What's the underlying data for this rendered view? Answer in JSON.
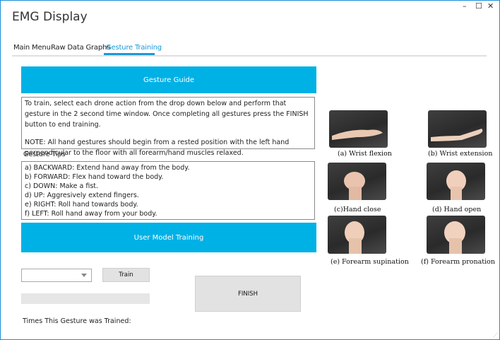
{
  "window": {
    "title": "EMG Display",
    "controls": {
      "minimize": "–",
      "maximize": "☐",
      "close": "✕"
    }
  },
  "tabs": [
    {
      "label": "Main Menu",
      "active": false
    },
    {
      "label": "Raw Data Graphs",
      "active": false
    },
    {
      "label": "Gesture Training",
      "active": true
    }
  ],
  "guide": {
    "header": "Gesture Guide",
    "instructions_line1": "To train, select each drone action from the drop down below and perform that gesture in the 2 second time window. Once completing all gestures press the FINISH button to end training.",
    "instructions_line2": "NOTE: All hand gestures should begin from a rested position with the left hand perpendicular to the floor with all forearm/hand muscles relaxed."
  },
  "tips": {
    "label": "Gesture Tips",
    "items": [
      "a) BACKWARD: Extend hand away from the body.",
      "b) FORWARD: Flex hand toward the body.",
      "c) DOWN: Make a fist.",
      "d) UP: Aggresively extend fingers.",
      "e) RIGHT: Roll hand towards body.",
      "f) LEFT: Roll hand away from your body."
    ]
  },
  "training": {
    "header": "User Model Training",
    "select_value": "",
    "train_label": "Train",
    "progress": 0,
    "finish_label": "FINISH",
    "times_label": "Times This Gesture was Trained:"
  },
  "gestures": [
    {
      "caption": "(a) Wrist flexion"
    },
    {
      "caption": "(b) Wrist extension"
    },
    {
      "caption": "(c)Hand close"
    },
    {
      "caption": "(d) Hand open"
    },
    {
      "caption": "(e)   Forearm supination"
    },
    {
      "caption": "(f) Forearm pronation"
    }
  ],
  "colors": {
    "accent": "#00b1e6",
    "tab_active": "#1a9ad7",
    "progress": "#06b025"
  }
}
